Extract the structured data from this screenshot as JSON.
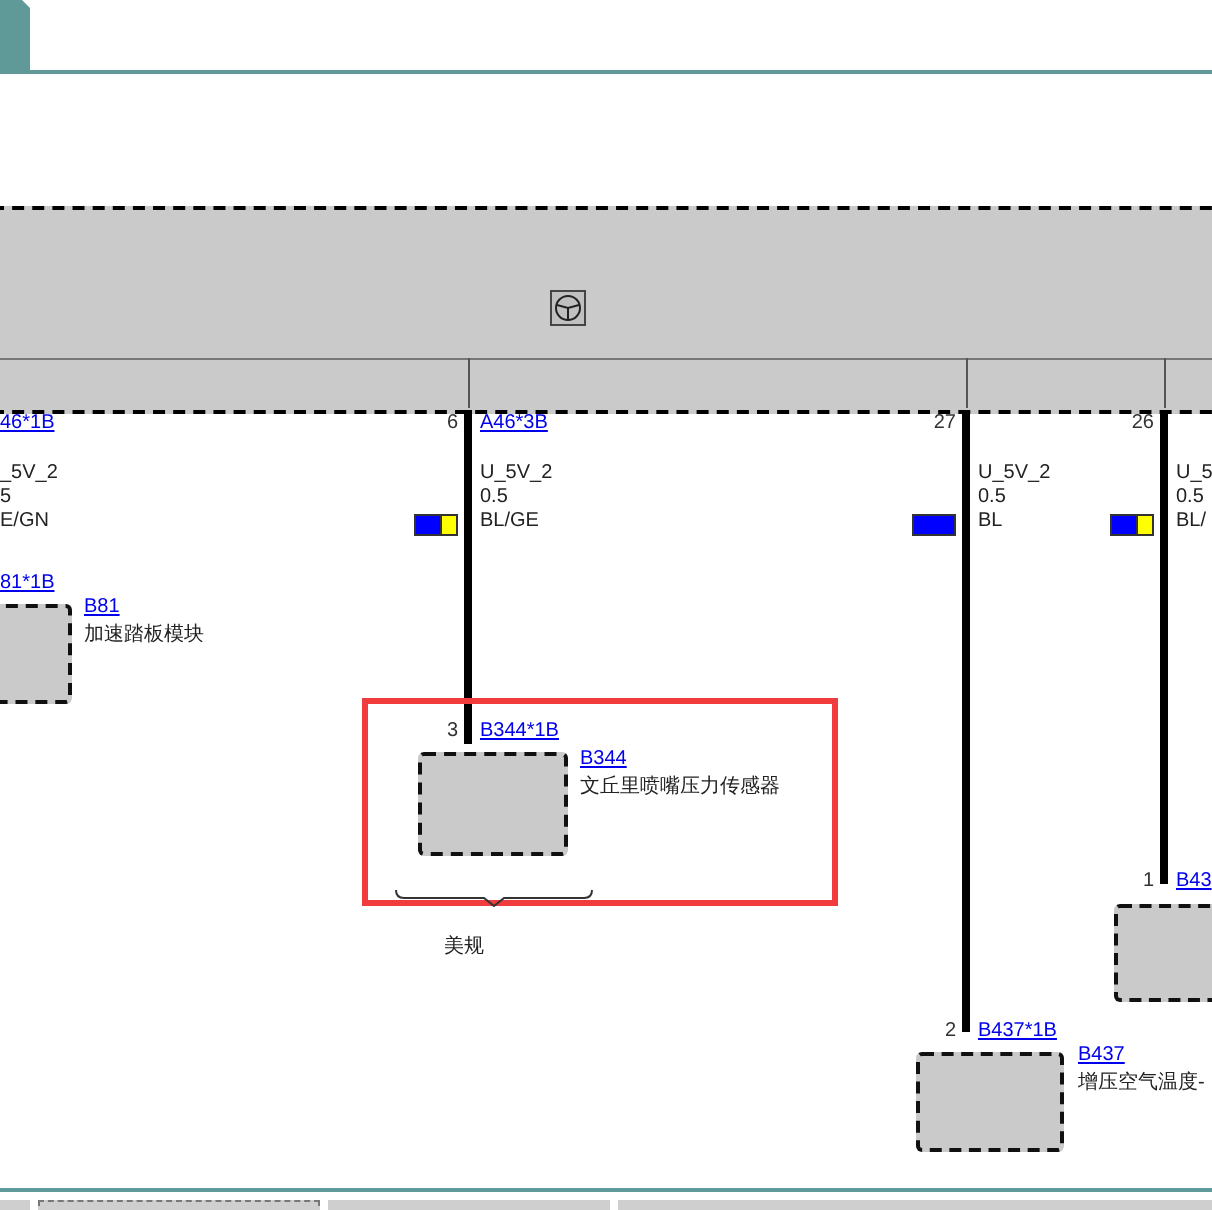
{
  "module": {
    "pins": [
      {
        "connector": "46*1B",
        "signal": "_5V_2",
        "size": "5",
        "color_code": "E/GN"
      },
      {
        "pin": "6",
        "connector": "A46*3B",
        "signal": "U_5V_2",
        "size": "0.5",
        "color_code": "BL/GE",
        "swatch": [
          {
            "color": "#0000ff"
          },
          {
            "color": "#ffff00"
          }
        ]
      },
      {
        "pin": "27",
        "signal": "U_5V_2",
        "size": "0.5",
        "color_code": "BL",
        "swatch": [
          {
            "color": "#0000ff"
          }
        ]
      },
      {
        "pin": "26",
        "signal": "U_5",
        "size": "0.5",
        "color_code": "BL/",
        "swatch": [
          {
            "color": "#0000ff"
          },
          {
            "color": "#ffff00"
          }
        ]
      }
    ]
  },
  "components": [
    {
      "connector": "81*1B",
      "code": "B81",
      "name": "加速踏板模块",
      "highlighted": false
    },
    {
      "pin": "3",
      "connector": "B344*1B",
      "code": "B344",
      "name": "文丘里喷嘴压力传感器",
      "highlighted": true,
      "variant": "美规"
    },
    {
      "pin": "1",
      "connector": "B43",
      "highlighted": false
    },
    {
      "pin": "2",
      "connector": "B437*1B",
      "code": "B437",
      "name": "增压空气温度-",
      "highlighted": false
    }
  ],
  "bottom_tabs": [
    {
      "selected": false
    },
    {
      "selected": true
    },
    {
      "selected": false
    },
    {
      "selected": false
    }
  ]
}
